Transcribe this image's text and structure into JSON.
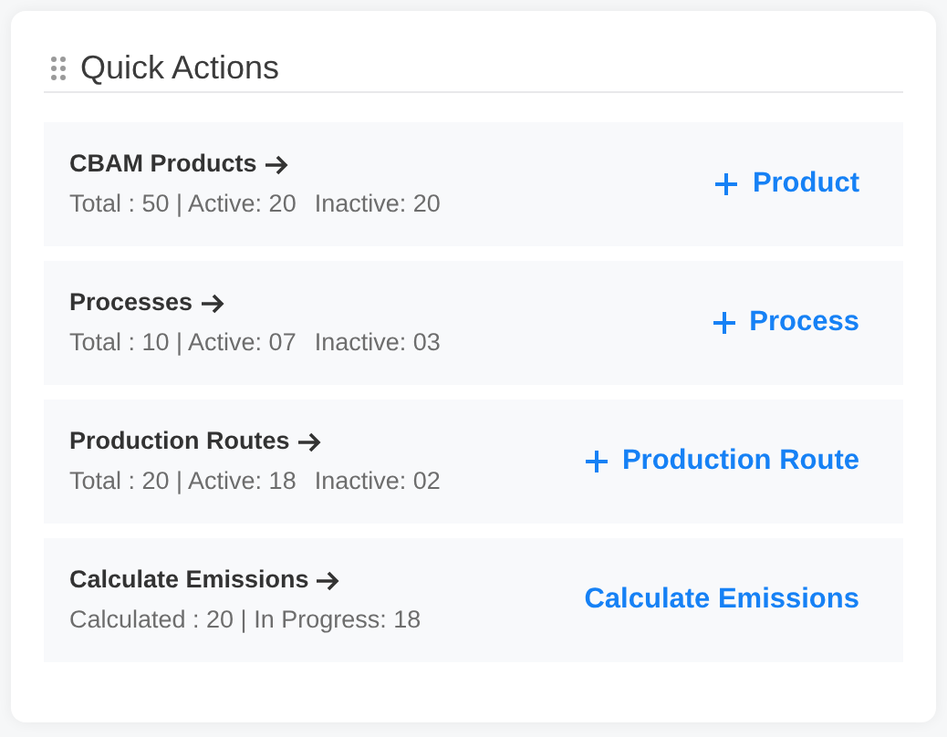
{
  "panel": {
    "title": "Quick Actions"
  },
  "actions": [
    {
      "title": "CBAM Products",
      "stats": [
        "Total : 50 | Active: 20",
        "Inactive: 20"
      ],
      "button": {
        "kind": "add",
        "label": "Product"
      }
    },
    {
      "title": "Processes",
      "stats": [
        "Total : 10 | Active: 07",
        "Inactive: 03"
      ],
      "button": {
        "kind": "add",
        "label": "Process"
      }
    },
    {
      "title": "Production Routes",
      "stats": [
        "Total : 20 | Active: 18",
        "Inactive: 02"
      ],
      "button": {
        "kind": "add",
        "label": "Production Route"
      }
    },
    {
      "title": "Calculate Emissions",
      "stats": [
        "Calculated : 20 | In Progress: 18"
      ],
      "button": {
        "kind": "plain",
        "label": "Calculate Emissions"
      }
    }
  ]
}
